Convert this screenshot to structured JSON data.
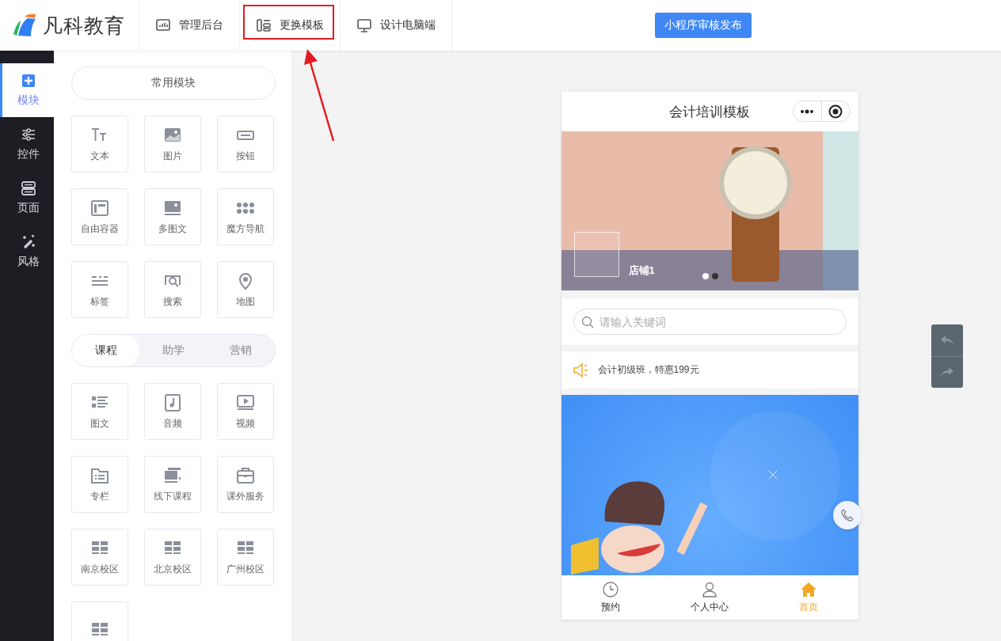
{
  "header": {
    "logo_text": "凡科教育",
    "nav": [
      {
        "label": "管理后台",
        "highlighted": false
      },
      {
        "label": "更换模板",
        "highlighted": true
      },
      {
        "label": "设计电脑端",
        "highlighted": false
      }
    ],
    "publish_button": "小程序审核发布"
  },
  "rail": [
    {
      "label": "模块",
      "selected": true
    },
    {
      "label": "控件",
      "selected": false
    },
    {
      "label": "页面",
      "selected": false
    },
    {
      "label": "风格",
      "selected": false
    }
  ],
  "panel": {
    "common_title": "常用模块",
    "common_modules": [
      {
        "label": "文本"
      },
      {
        "label": "图片"
      },
      {
        "label": "按钮"
      },
      {
        "label": "自由容器"
      },
      {
        "label": "多图文"
      },
      {
        "label": "魔方导航"
      },
      {
        "label": "标签"
      },
      {
        "label": "搜索"
      },
      {
        "label": "地图"
      }
    ],
    "category_tabs": [
      {
        "label": "课程",
        "selected": true
      },
      {
        "label": "助学",
        "selected": false
      },
      {
        "label": "营销",
        "selected": false
      }
    ],
    "course_modules": [
      {
        "kind": "labeled",
        "label": "图文"
      },
      {
        "kind": "labeled",
        "label": "音频"
      },
      {
        "kind": "labeled",
        "label": "视频"
      },
      {
        "kind": "labeled",
        "label": "专栏"
      },
      {
        "kind": "labeled",
        "label": "线下课程"
      },
      {
        "kind": "labeled",
        "label": "课外服务"
      },
      {
        "kind": "labeled",
        "label": "南京校区"
      },
      {
        "kind": "labeled",
        "label": "北京校区"
      },
      {
        "kind": "labeled",
        "label": "广州校区"
      },
      {
        "kind": "unlabeled"
      }
    ]
  },
  "phone": {
    "title": "会计培训模板",
    "banner": {
      "caption": "店铺1",
      "dots": [
        {
          "selected": true
        },
        {
          "selected": false
        }
      ]
    },
    "search": {
      "placeholder": "请输入关键词"
    },
    "notice": "会计初级班，特惠199元",
    "tabbar": [
      {
        "label": "预约",
        "selected": false
      },
      {
        "label": "个人中心",
        "selected": false
      },
      {
        "label": "首页",
        "selected": true
      }
    ]
  }
}
